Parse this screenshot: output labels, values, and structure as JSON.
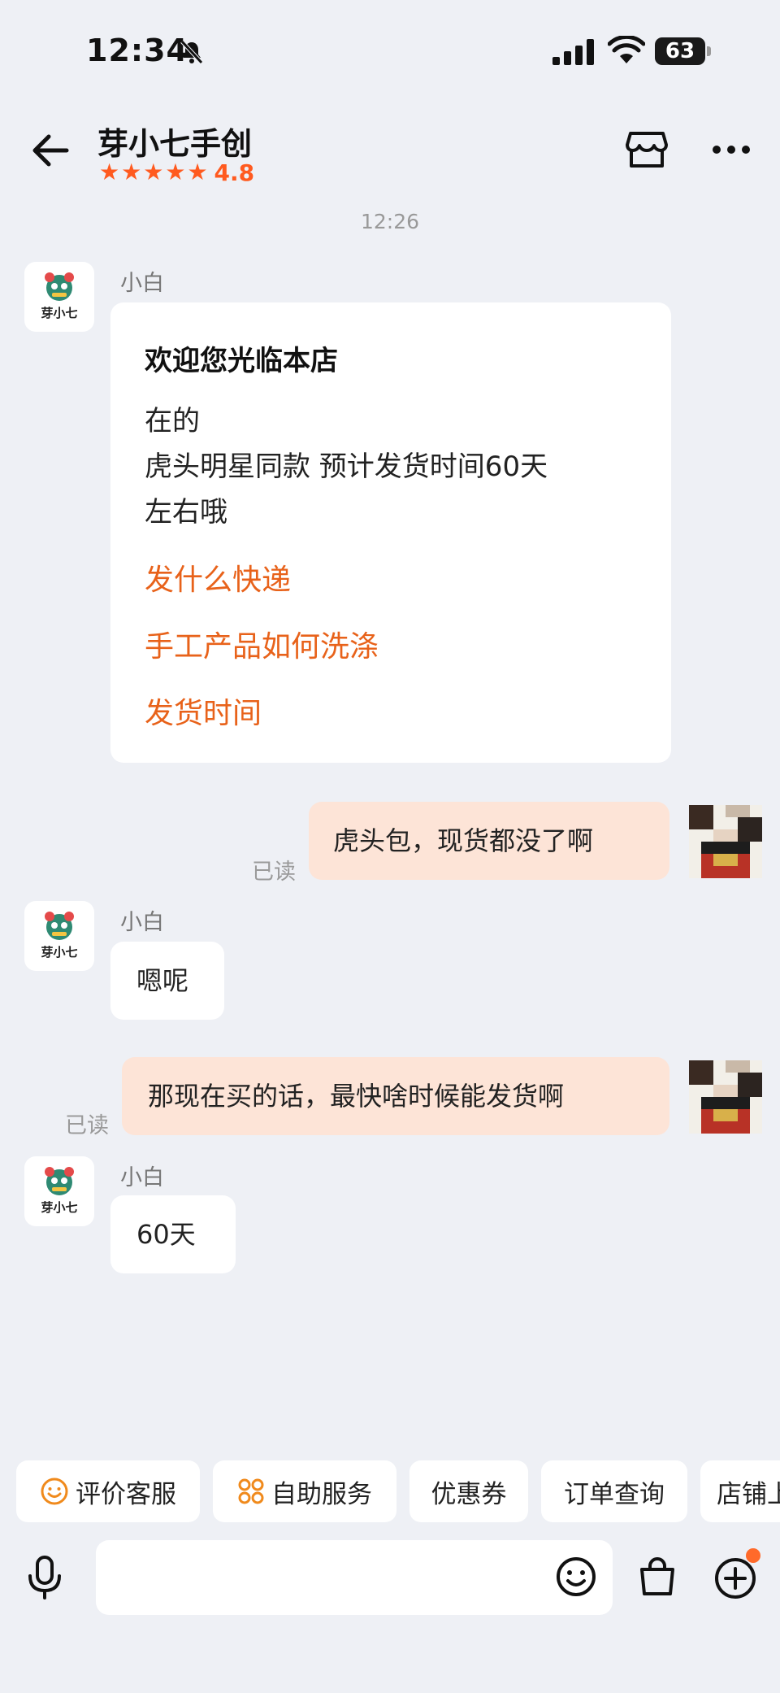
{
  "status_bar": {
    "time": "12:34",
    "battery": "63"
  },
  "header": {
    "title": "芽小七手创",
    "stars": 5,
    "rating": "4.8"
  },
  "timestamp": "12:26",
  "messages": [
    {
      "sender": "小白",
      "avatar_label": "芽小七",
      "greeting": "欢迎您光临本店",
      "lines": [
        "在的",
        "虎头明星同款 预计发货时间60天",
        "左右哦"
      ],
      "links": [
        "发什么快递",
        "手工产品如何洗涤",
        "发货时间"
      ]
    },
    {
      "self": true,
      "read_label": "已读",
      "text": "虎头包，现货都没了啊"
    },
    {
      "sender": "小白",
      "avatar_label": "芽小七",
      "text": "嗯呢"
    },
    {
      "self": true,
      "read_label": "已读",
      "text": "那现在买的话，最快啥时候能发货啊"
    },
    {
      "sender": "小白",
      "avatar_label": "芽小七",
      "text": "60天"
    }
  ],
  "quick_actions": [
    "评价客服",
    "自助服务",
    "优惠券",
    "订单查询",
    "店铺上"
  ],
  "icons": {
    "status": [
      "bell-muted-icon",
      "signal-icon",
      "wifi-icon",
      "battery-icon"
    ],
    "header": [
      "back-arrow-icon",
      "store-icon",
      "more-icon"
    ],
    "input_bar": [
      "microphone-icon",
      "emoji-icon",
      "shopping-bag-icon",
      "plus-circle-icon"
    ]
  },
  "colors": {
    "accent": "#ff5a1f",
    "link": "#e8621a",
    "self_bubble": "#fde4d7",
    "background": "#eef0f5"
  }
}
